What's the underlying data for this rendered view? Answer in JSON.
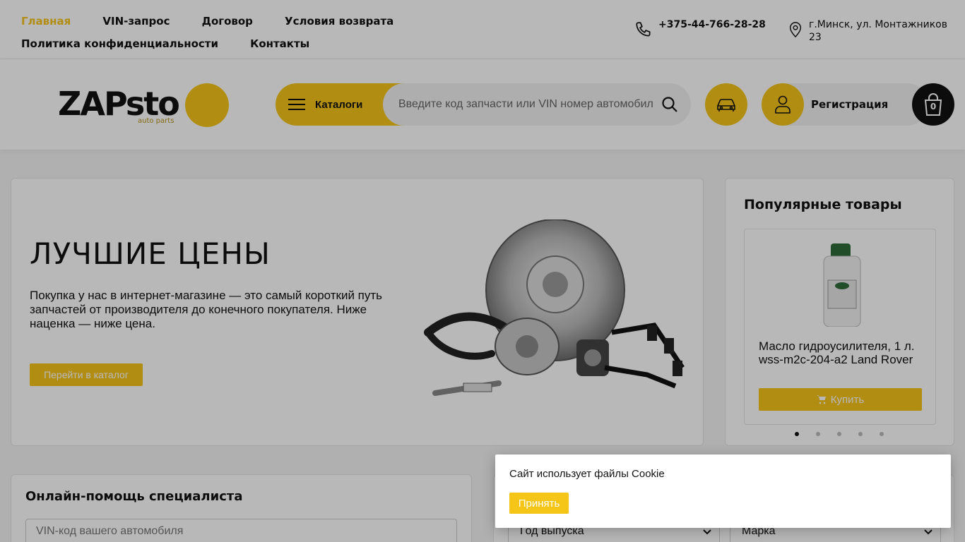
{
  "topnav": {
    "items": [
      "Главная",
      "VIN-запрос",
      "Договор",
      "Условия возврата",
      "Политика конфиденциальности",
      "Контакты"
    ]
  },
  "contacts": {
    "phone": "+375-44-766-28-28",
    "address": "г.Минск, ул. Монтажников 23"
  },
  "header": {
    "logo_text": "ZAPsto",
    "logo_tagline": "auto parts",
    "catalog_label": "Каталоги",
    "search_placeholder": "Введите код запчасти или VIN номер автомобиля",
    "register_label": "Регистрация",
    "cart_count": "0"
  },
  "hero": {
    "title": "ЛУЧШИЕ ЦЕНЫ",
    "text": "Покупка у нас в интернет-магазине — это самый короткий путь запчастей от производителя до конечного покупателя. Ниже наценка — ниже цена.",
    "cta_label": "Перейти в каталог"
  },
  "popular": {
    "title": "Популярные товары",
    "product_name": "Масло гидроусилителя, 1 л. wss-m2c-204-a2 Land Rover",
    "buy_label": "Купить",
    "slides": 5,
    "active_slide": 1
  },
  "help": {
    "title": "Онлайн-помощь специалиста",
    "vin_placeholder": "VIN-код вашего автомобиля"
  },
  "selector": {
    "year_label": "Год выпуска",
    "brand_label": "Марка"
  },
  "cookie": {
    "message": "Сайт использует файлы Cookie",
    "accept_label": "Принять"
  },
  "colors": {
    "accent": "#f5c518",
    "dark": "#111111"
  }
}
